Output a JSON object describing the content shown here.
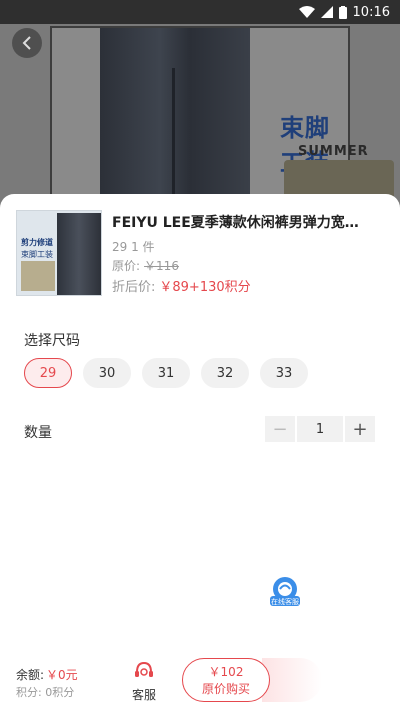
{
  "status_bar": {
    "time": "10:16"
  },
  "background": {
    "banner_text": "束脚工装",
    "banner_sub": "SUMMER"
  },
  "product": {
    "title": "FEIYU LEE夏季薄款休闲裤男弹力宽松...",
    "stock": "29 1 件",
    "original_price_label": "原价:",
    "original_price": "￥116",
    "deal_price_label": "折后价:",
    "deal_price": "￥89+130积分",
    "thumb_text_1": "剪力修道",
    "thumb_text_2": "束脚工装"
  },
  "size_section": {
    "title": "选择尺码",
    "options": [
      "29",
      "30",
      "31",
      "32",
      "33"
    ],
    "selected": "29"
  },
  "quantity": {
    "label": "数量",
    "value": "1",
    "minus": "−",
    "plus": "+"
  },
  "floating_service": {
    "label": "在线客服"
  },
  "bottom_bar": {
    "balance_label": "余额:",
    "balance_value": "￥0元",
    "points_text": "积分: 0积分",
    "service_label": "客服",
    "buy_price": "￥102",
    "buy_label": "原价购买"
  },
  "colors": {
    "accent": "#e5484d",
    "chip_bg": "#f1f1f1",
    "selected_bg": "#fdeced"
  }
}
